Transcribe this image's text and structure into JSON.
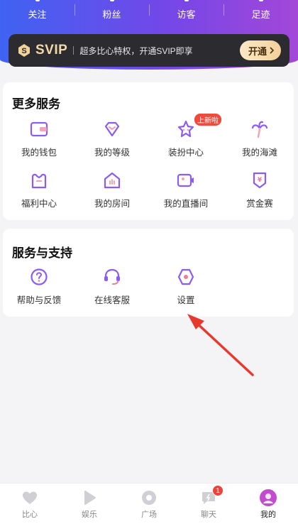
{
  "stats": [
    "关注",
    "粉丝",
    "访客",
    "足迹"
  ],
  "vip": {
    "title": "SVIP",
    "description": "超多比心特权，开通SVIP即享",
    "button": "开通"
  },
  "more_services": {
    "title": "更多服务",
    "items": [
      {
        "label": "我的钱包",
        "icon": "wallet-icon"
      },
      {
        "label": "我的等级",
        "icon": "diamond-icon"
      },
      {
        "label": "装扮中心",
        "icon": "star-icon",
        "badge": "上新啦"
      },
      {
        "label": "我的海滩",
        "icon": "palm-tree-icon"
      },
      {
        "label": "福利中心",
        "icon": "gift-icon"
      },
      {
        "label": "我的房间",
        "icon": "house-icon"
      },
      {
        "label": "我的直播间",
        "icon": "live-camera-icon"
      },
      {
        "label": "赏金赛",
        "icon": "bounty-icon"
      }
    ]
  },
  "support": {
    "title": "服务与支持",
    "items": [
      {
        "label": "帮助与反馈",
        "icon": "help-icon"
      },
      {
        "label": "在线客服",
        "icon": "headset-icon"
      },
      {
        "label": "设置",
        "icon": "settings-icon"
      }
    ]
  },
  "tabs": [
    {
      "label": "比心",
      "icon": "heart-icon"
    },
    {
      "label": "娱乐",
      "icon": "play-icon"
    },
    {
      "label": "广场",
      "icon": "disc-icon"
    },
    {
      "label": "聊天",
      "icon": "chat-icon",
      "badge": "1"
    },
    {
      "label": "我的",
      "icon": "avatar-icon",
      "active": true
    }
  ],
  "colors": {
    "accent": "#8a5cf5",
    "hero_start": "#3f63f2",
    "hero_end": "#a347d8",
    "arrow": "#e8392e"
  }
}
